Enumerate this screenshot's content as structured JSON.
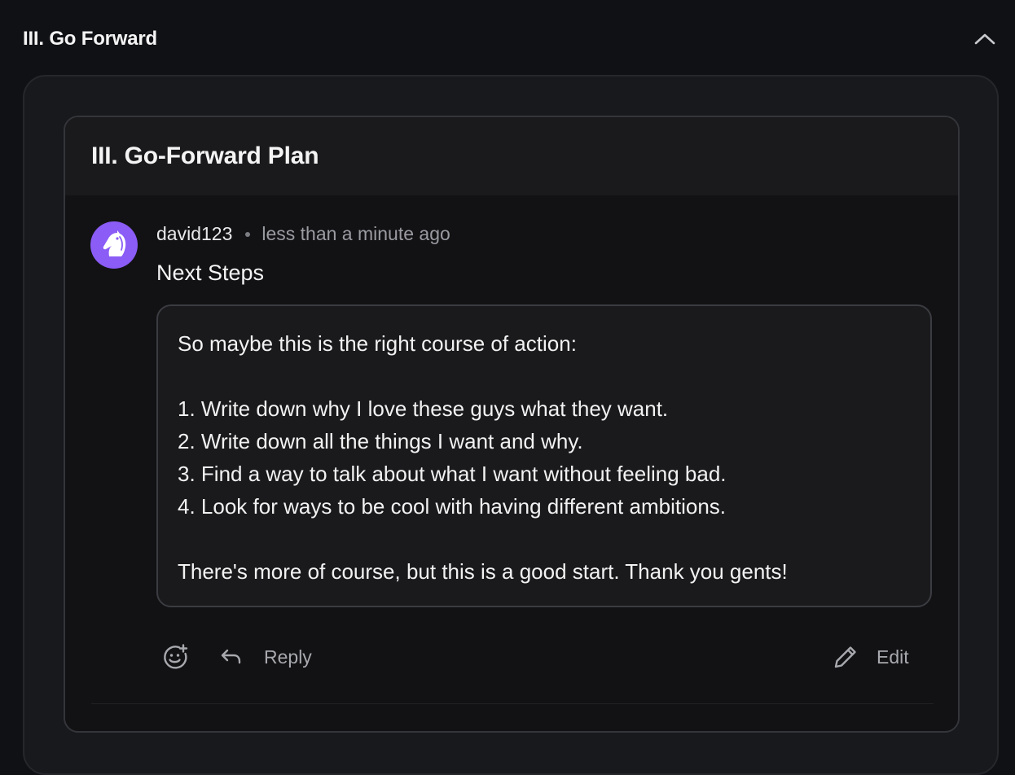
{
  "section": {
    "title": "III. Go Forward",
    "collapse_icon": "chevron-up-icon"
  },
  "card": {
    "title": "III. Go-Forward Plan"
  },
  "comment": {
    "author": "david123",
    "timestamp": "less than a minute ago",
    "avatar_icon": "horse-head-icon",
    "avatar_color": "#8b5cf6",
    "title": "Next Steps",
    "body_lines": [
      "So maybe this is the right course of action:",
      "",
      "1. Write down why I love these guys what they want.",
      "2. Write down all the things I want and why.",
      "3. Find a way to talk about what I want without feeling bad.",
      "4. Look for ways to be cool with having different ambitions.",
      "",
      "There's more of course, but this is a good start. Thank you gents!"
    ]
  },
  "actions": {
    "add_reaction_icon": "smile-plus-icon",
    "reply_icon": "reply-arrow-icon",
    "reply_label": "Reply",
    "edit_icon": "pencil-icon",
    "edit_label": "Edit"
  }
}
